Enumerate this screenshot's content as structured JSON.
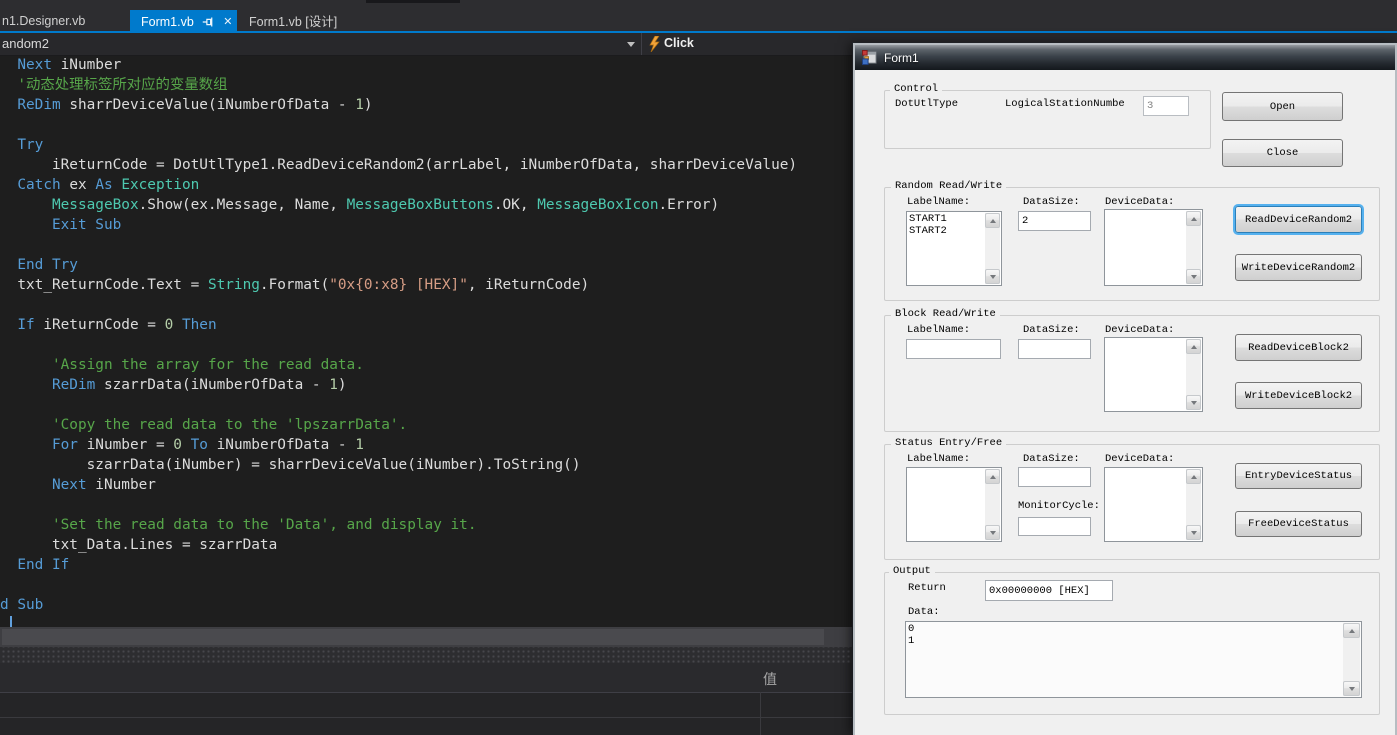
{
  "vs": {
    "tabs": [
      {
        "label": "n1.Designer.vb"
      },
      {
        "label": "Form1.vb"
      },
      {
        "label": "Form1.vb [设计]"
      }
    ],
    "navbar": {
      "scope": "andom2",
      "event": "Click"
    },
    "code_lines": [
      [
        [
          "p",
          "  "
        ],
        [
          "k",
          "Next"
        ],
        [
          "p",
          " iNumber"
        ]
      ],
      [
        [
          "p",
          "  "
        ],
        [
          "c",
          "'动态处理标签所对应的变量数组"
        ]
      ],
      [
        [
          "p",
          "  "
        ],
        [
          "k",
          "ReDim"
        ],
        [
          "p",
          " sharrDeviceValue(iNumberOfData - "
        ],
        [
          "n",
          "1"
        ],
        [
          "p",
          ")"
        ]
      ],
      [],
      [
        [
          "p",
          "  "
        ],
        [
          "k",
          "Try"
        ]
      ],
      [
        [
          "p",
          "      iReturnCode = DotUtlType1.ReadDeviceRandom2(arrLabel, iNumberOfData, sharrDeviceValue)"
        ]
      ],
      [
        [
          "p",
          "  "
        ],
        [
          "k",
          "Catch"
        ],
        [
          "p",
          " ex "
        ],
        [
          "k",
          "As"
        ],
        [
          "p",
          " "
        ],
        [
          "t",
          "Exception"
        ]
      ],
      [
        [
          "p",
          "      "
        ],
        [
          "t",
          "MessageBox"
        ],
        [
          "p",
          ".Show(ex.Message, Name, "
        ],
        [
          "t",
          "MessageBoxButtons"
        ],
        [
          "p",
          ".OK, "
        ],
        [
          "t",
          "MessageBoxIcon"
        ],
        [
          "p",
          ".Error)"
        ]
      ],
      [
        [
          "p",
          "      "
        ],
        [
          "k",
          "Exit Sub"
        ]
      ],
      [],
      [
        [
          "p",
          "  "
        ],
        [
          "k",
          "End Try"
        ]
      ],
      [
        [
          "p",
          "  txt_ReturnCode.Text = "
        ],
        [
          "t",
          "String"
        ],
        [
          "p",
          ".Format("
        ],
        [
          "s",
          "\"0x{0:x8} [HEX]\""
        ],
        [
          "p",
          ", iReturnCode)"
        ]
      ],
      [],
      [
        [
          "p",
          "  "
        ],
        [
          "k",
          "If"
        ],
        [
          "p",
          " iReturnCode = "
        ],
        [
          "n",
          "0"
        ],
        [
          "p",
          " "
        ],
        [
          "k",
          "Then"
        ]
      ],
      [],
      [
        [
          "p",
          "      "
        ],
        [
          "c",
          "'Assign the array for the read data."
        ]
      ],
      [
        [
          "p",
          "      "
        ],
        [
          "k",
          "ReDim"
        ],
        [
          "p",
          " szarrData(iNumberOfData - "
        ],
        [
          "n",
          "1"
        ],
        [
          "p",
          ")"
        ]
      ],
      [],
      [
        [
          "p",
          "      "
        ],
        [
          "c",
          "'Copy the read data to the 'lpszarrData'."
        ]
      ],
      [
        [
          "p",
          "      "
        ],
        [
          "k",
          "For"
        ],
        [
          "p",
          " iNumber = "
        ],
        [
          "n",
          "0"
        ],
        [
          "p",
          " "
        ],
        [
          "k",
          "To"
        ],
        [
          "p",
          " iNumberOfData - "
        ],
        [
          "n",
          "1"
        ]
      ],
      [
        [
          "p",
          "          szarrData(iNumber) = sharrDeviceValue(iNumber).ToString()"
        ]
      ],
      [
        [
          "p",
          "      "
        ],
        [
          "k",
          "Next"
        ],
        [
          "p",
          " iNumber"
        ]
      ],
      [],
      [
        [
          "p",
          "      "
        ],
        [
          "c",
          "'Set the read data to the 'Data', and display it."
        ]
      ],
      [
        [
          "p",
          "      txt_Data.Lines = szarrData"
        ]
      ],
      [
        [
          "p",
          "  "
        ],
        [
          "k",
          "End If"
        ]
      ],
      [],
      [
        [
          "k",
          "d Sub"
        ]
      ]
    ],
    "watch": {
      "value_header": "值"
    }
  },
  "form": {
    "title": "Form1",
    "control": {
      "title": "Control",
      "dotutltype_label": "DotUtlType",
      "logical_station_label": "LogicalStationNumbe",
      "logical_station_value": "3"
    },
    "open_button": "Open",
    "close_button": "Close",
    "random": {
      "title": "Random Read/Write",
      "labelname_label": "LabelName:",
      "labelname_value": "START1\nSTART2",
      "datasize_label": "DataSize:",
      "datasize_value": "2",
      "devicedata_label": "DeviceData:",
      "devicedata_value": "",
      "read_button": "ReadDeviceRandom2",
      "write_button": "WriteDeviceRandom2"
    },
    "block": {
      "title": "Block Read/Write",
      "labelname_label": "LabelName:",
      "labelname_value": "",
      "datasize_label": "DataSize:",
      "datasize_value": "",
      "devicedata_label": "DeviceData:",
      "devicedata_value": "",
      "read_button": "ReadDeviceBlock2",
      "write_button": "WriteDeviceBlock2"
    },
    "status": {
      "title": "Status Entry/Free",
      "labelname_label": "LabelName:",
      "labelname_value": "",
      "datasize_label": "DataSize:",
      "datasize_value": "",
      "monitorcycle_label": "MonitorCycle:",
      "monitorcycle_value": "",
      "devicedata_label": "DeviceData:",
      "devicedata_value": "",
      "entry_button": "EntryDeviceStatus",
      "free_button": "FreeDeviceStatus"
    },
    "output": {
      "title": "Output",
      "return_label": "Return",
      "return_value": "0x00000000 [HEX]",
      "data_label": "Data:",
      "data_value": "0\n1"
    }
  }
}
